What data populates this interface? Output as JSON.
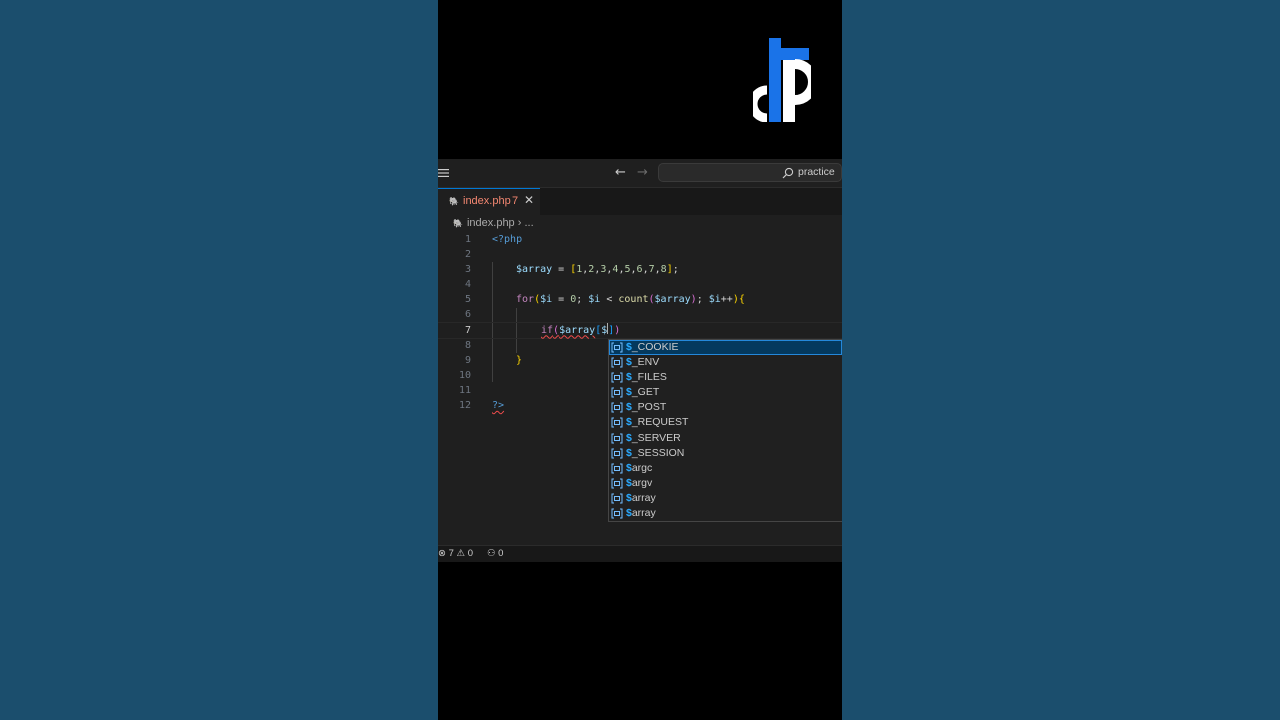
{
  "theme": {
    "background": "#1b4e6d",
    "accent": "#0078d4",
    "error": "#f14c4c",
    "logo_blue": "#1a73e8"
  },
  "titlebar": {
    "search_text": "practice"
  },
  "tab": {
    "file_name": "index.php",
    "problem_count": "7"
  },
  "breadcrumb": {
    "file": "index.php",
    "separator": "›",
    "rest": "..."
  },
  "editor": {
    "current_line": 7,
    "line_numbers": [
      "1",
      "2",
      "3",
      "4",
      "5",
      "6",
      "7",
      "8",
      "9",
      "10",
      "11",
      "12"
    ],
    "lines": [
      "<?php",
      "",
      "    $array = [1,2,3,4,5,6,7,8];",
      "",
      "    for($i = 0; $i < count($array); $i++){",
      "",
      "        if($array[$])",
      "",
      "    }",
      "",
      "",
      "?>"
    ]
  },
  "suggestions": {
    "items": [
      {
        "prefix": "$",
        "rest": "_COOKIE",
        "icon": "variable-icon"
      },
      {
        "prefix": "$",
        "rest": "_ENV",
        "icon": "variable-icon"
      },
      {
        "prefix": "$",
        "rest": "_FILES",
        "icon": "variable-icon"
      },
      {
        "prefix": "$",
        "rest": "_GET",
        "icon": "variable-icon"
      },
      {
        "prefix": "$",
        "rest": "_POST",
        "icon": "variable-icon"
      },
      {
        "prefix": "$",
        "rest": "_REQUEST",
        "icon": "variable-icon"
      },
      {
        "prefix": "$",
        "rest": "_SERVER",
        "icon": "variable-icon"
      },
      {
        "prefix": "$",
        "rest": "_SESSION",
        "icon": "variable-icon"
      },
      {
        "prefix": "$",
        "rest": "argc",
        "icon": "variable-icon"
      },
      {
        "prefix": "$",
        "rest": "argv",
        "icon": "variable-icon"
      },
      {
        "prefix": "$",
        "rest": "array",
        "icon": "variable-icon"
      },
      {
        "prefix": "$",
        "rest": "array",
        "icon": "variable-icon"
      }
    ]
  },
  "statusbar": {
    "errors": "7",
    "warnings": "0",
    "ports": "0"
  }
}
